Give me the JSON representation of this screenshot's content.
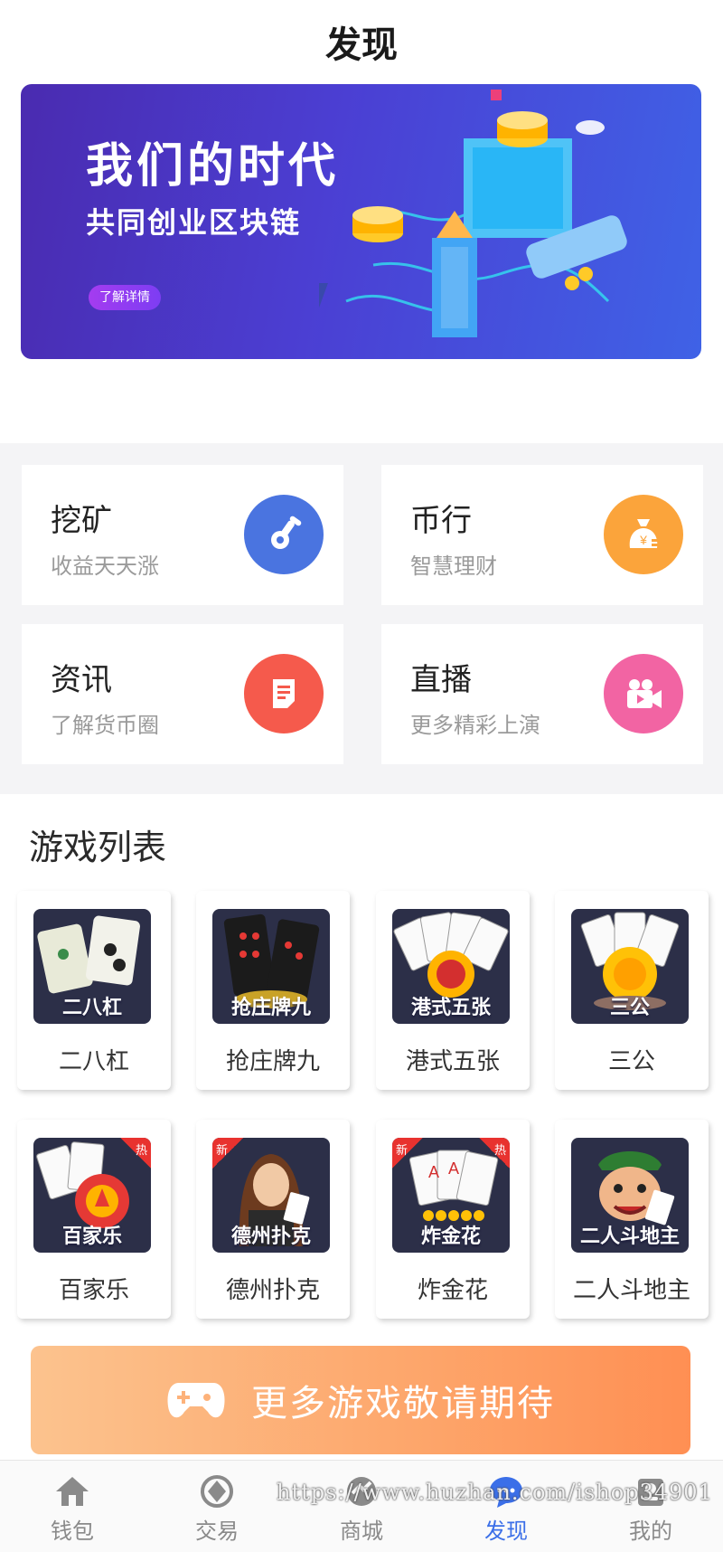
{
  "header": {
    "title": "发现"
  },
  "banner": {
    "title": "我们的时代",
    "subtitle": "共同创业区块链",
    "button": "了解详情"
  },
  "features": [
    {
      "title": "挖矿",
      "subtitle": "收益天天涨",
      "icon": "mining-icon",
      "color": "#4a74e0"
    },
    {
      "title": "币行",
      "subtitle": "智慧理财",
      "icon": "money-bag-icon",
      "color": "#fba43b"
    },
    {
      "title": "资讯",
      "subtitle": "了解货币圈",
      "icon": "news-icon",
      "color": "#f55a4c"
    },
    {
      "title": "直播",
      "subtitle": "更多精彩上演",
      "icon": "video-camera-icon",
      "color": "#f264a3"
    }
  ],
  "games": {
    "section_title": "游戏列表",
    "items": [
      {
        "name": "二八杠",
        "caption": "二八杠",
        "tag_new": "",
        "tag_hot": ""
      },
      {
        "name": "抢庄牌九",
        "caption": "抢庄牌九",
        "tag_new": "",
        "tag_hot": ""
      },
      {
        "name": "港式五张",
        "caption": "港式五张",
        "tag_new": "",
        "tag_hot": ""
      },
      {
        "name": "三公",
        "caption": "三公",
        "tag_new": "",
        "tag_hot": ""
      },
      {
        "name": "百家乐",
        "caption": "百家乐",
        "tag_new": "",
        "tag_hot": "热"
      },
      {
        "name": "德州扑克",
        "caption": "德州扑克",
        "tag_new": "新",
        "tag_hot": ""
      },
      {
        "name": "炸金花",
        "caption": "炸金花",
        "tag_new": "新",
        "tag_hot": "热"
      },
      {
        "name": "二人斗地主",
        "caption": "二人斗地主",
        "tag_new": "",
        "tag_hot": ""
      }
    ]
  },
  "more_games": {
    "label": "更多游戏敬请期待",
    "icon": "gamepad-icon"
  },
  "tabbar": {
    "items": [
      {
        "label": "钱包",
        "icon": "home-icon",
        "active": false
      },
      {
        "label": "交易",
        "icon": "exchange-icon",
        "active": false
      },
      {
        "label": "商城",
        "icon": "shop-icon",
        "active": false
      },
      {
        "label": "发现",
        "icon": "discover-icon",
        "active": true
      },
      {
        "label": "我的",
        "icon": "profile-icon",
        "active": false
      }
    ]
  },
  "watermark": "https://www.huzhan.com/ishop34901"
}
